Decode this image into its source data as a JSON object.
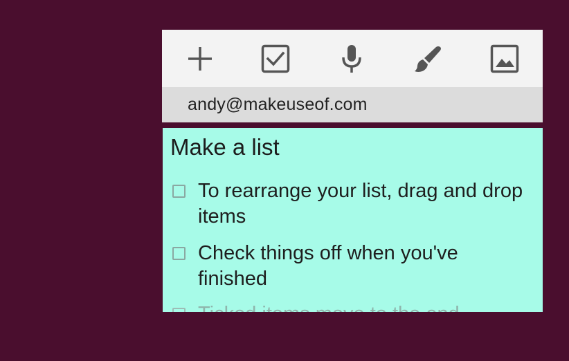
{
  "toolbar": {
    "buttons": [
      {
        "icon": "plus-icon",
        "action": "new-note"
      },
      {
        "icon": "checkbox-icon",
        "action": "new-list"
      },
      {
        "icon": "microphone-icon",
        "action": "audio-note"
      },
      {
        "icon": "brush-icon",
        "action": "drawing-note"
      },
      {
        "icon": "image-icon",
        "action": "photo-note"
      }
    ],
    "icon_color": "#555555"
  },
  "account": {
    "email": "andy@makeuseof.com"
  },
  "note": {
    "title": "Make a list",
    "background_color": "#a7fbe8",
    "items": [
      {
        "text": "To rearrange your list, drag and drop items",
        "checked": false
      },
      {
        "text": "Check things off when you've finished",
        "checked": false
      },
      {
        "text": "Ticked items move to the end",
        "checked": false
      }
    ]
  },
  "colors": {
    "background": "#4a0e2e",
    "toolbar": "#f3f3f3",
    "account_bar": "#dcdcdc"
  }
}
